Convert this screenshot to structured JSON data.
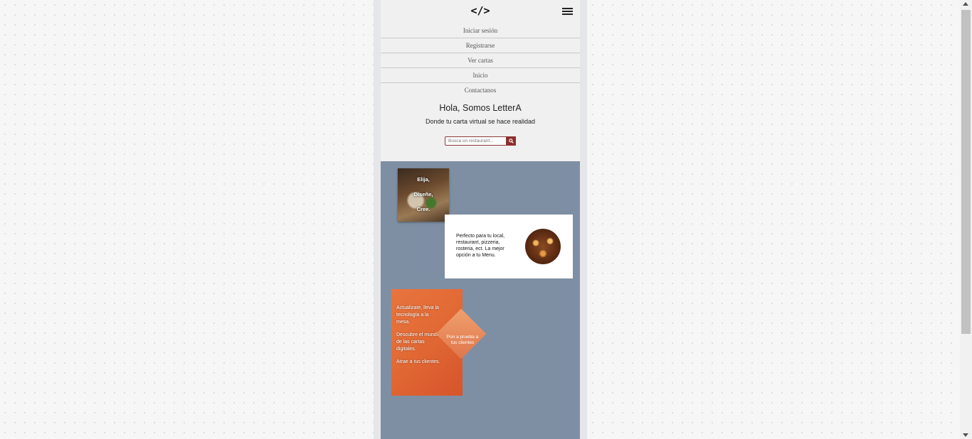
{
  "header": {
    "logo": "</>",
    "menu_icon": "hamburger-menu-icon"
  },
  "nav": {
    "items": [
      "Iniciar sesión",
      "Registrarse",
      "Ver cartas",
      "Inicio",
      "Contactanos"
    ]
  },
  "hero": {
    "title": "Hola, Somos LetterA",
    "subtitle": "Donde tu carta virtual se hace realidad"
  },
  "search": {
    "placeholder": "Busca un restaurant...",
    "button_icon": "search-icon"
  },
  "card1": {
    "lines": [
      "Elija,",
      "Diseñe,",
      "Cree."
    ]
  },
  "card2": {
    "text": "Perfecto para tu local, restaurant, pizzeria, rosteria, ect. La mejor opción a tu Menu."
  },
  "card3": {
    "paragraphs": [
      "Actualizate, lleva la tecnología a la mesa.",
      "Descubre el mundo de las cartas digitales.",
      "Atrae a tus clientes."
    ],
    "cta_label": "Pon a prueba a tus clientes"
  },
  "colors": {
    "background": "#f6f6f6",
    "section_blue": "#7f8fa3",
    "accent_red": "#8f2f2f",
    "orange": "#e26a35"
  }
}
